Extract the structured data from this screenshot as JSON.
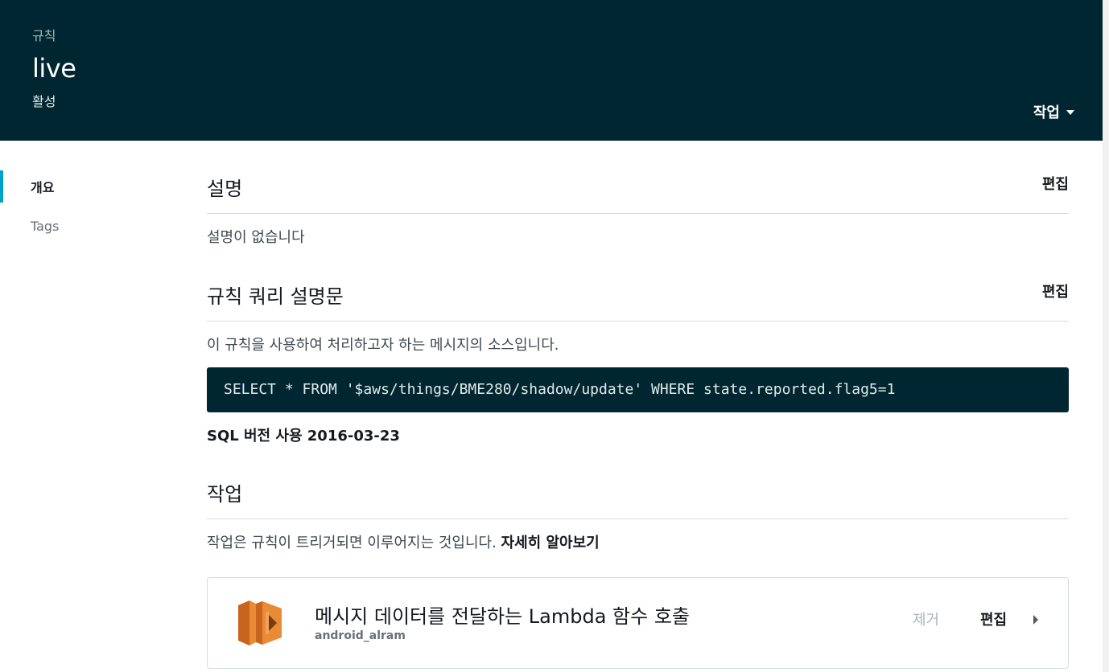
{
  "header": {
    "breadcrumb": "규칙",
    "title": "live",
    "status": "활성",
    "actions_label": "작업"
  },
  "sidenav": {
    "items": [
      {
        "label": "개요",
        "active": true
      },
      {
        "label": "Tags",
        "active": false
      }
    ]
  },
  "description": {
    "heading": "설명",
    "edit_label": "편집",
    "text": "설명이 없습니다"
  },
  "query": {
    "heading": "규칙 쿼리 설명문",
    "edit_label": "편집",
    "text": "이 규칙을 사용하여 처리하고자 하는 메시지의 소스입니다.",
    "sql": "SELECT * FROM '$aws/things/BME280/shadow/update' WHERE state.reported.flag5=1",
    "sql_version": "SQL 버전 사용 2016-03-23"
  },
  "actions": {
    "heading": "작업",
    "text": "작업은 규칙이 트리거되면 이루어지는 것입니다.",
    "learn_more": "자세히 알아보기",
    "items": [
      {
        "icon": "lambda-icon",
        "title": "메시지 데이터를 전달하는 Lambda 함수 호출",
        "subtitle": "android_alram",
        "remove_label": "제거",
        "edit_label": "편집"
      }
    ]
  },
  "colors": {
    "header_bg": "#002631",
    "accent": "#00a1c9",
    "lambda_orange": "#e07b2a"
  }
}
